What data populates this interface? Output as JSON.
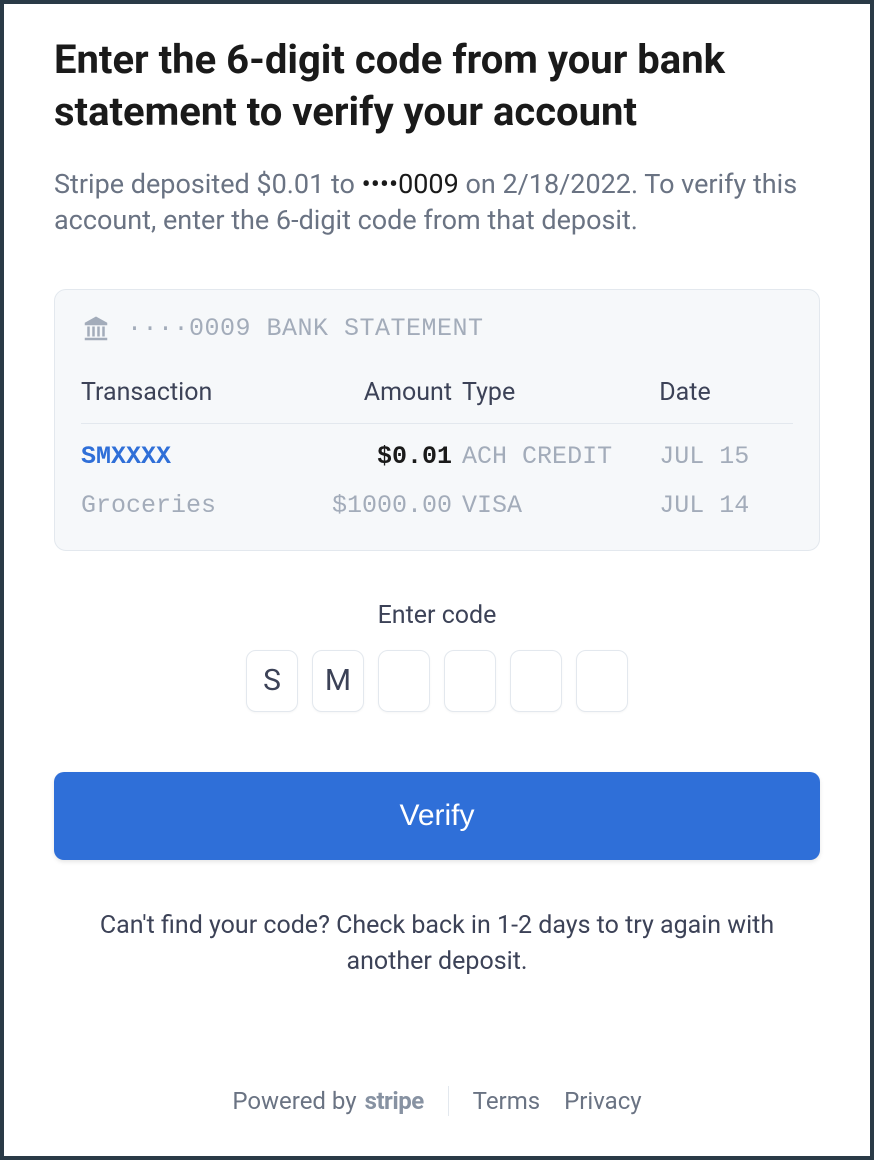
{
  "title": "Enter the 6-digit code from your bank statement to verify your account",
  "subtitle_prefix": "Stripe deposited $0.01 to ",
  "subtitle_account": "••••0009",
  "subtitle_suffix": " on 2/18/2022. To verify this account, enter the 6-digit code from that deposit.",
  "statement": {
    "label": "····0009 BANK STATEMENT",
    "columns": {
      "transaction": "Transaction",
      "amount": "Amount",
      "type": "Type",
      "date": "Date"
    },
    "rows": [
      {
        "transaction": "SMXXXX",
        "amount": "$0.01",
        "type": "ACH CREDIT",
        "date": "JUL 15",
        "highlight": true
      },
      {
        "transaction": "Groceries",
        "amount": "$1000.00",
        "type": "VISA",
        "date": "JUL 14",
        "highlight": false
      }
    ]
  },
  "code": {
    "label": "Enter code",
    "values": [
      "S",
      "M",
      "",
      "",
      "",
      ""
    ]
  },
  "verify_label": "Verify",
  "help_text": "Can't find your code? Check back in 1-2 days to try again with another deposit.",
  "footer": {
    "powered_by": "Powered by",
    "brand": "stripe",
    "terms": "Terms",
    "privacy": "Privacy"
  }
}
